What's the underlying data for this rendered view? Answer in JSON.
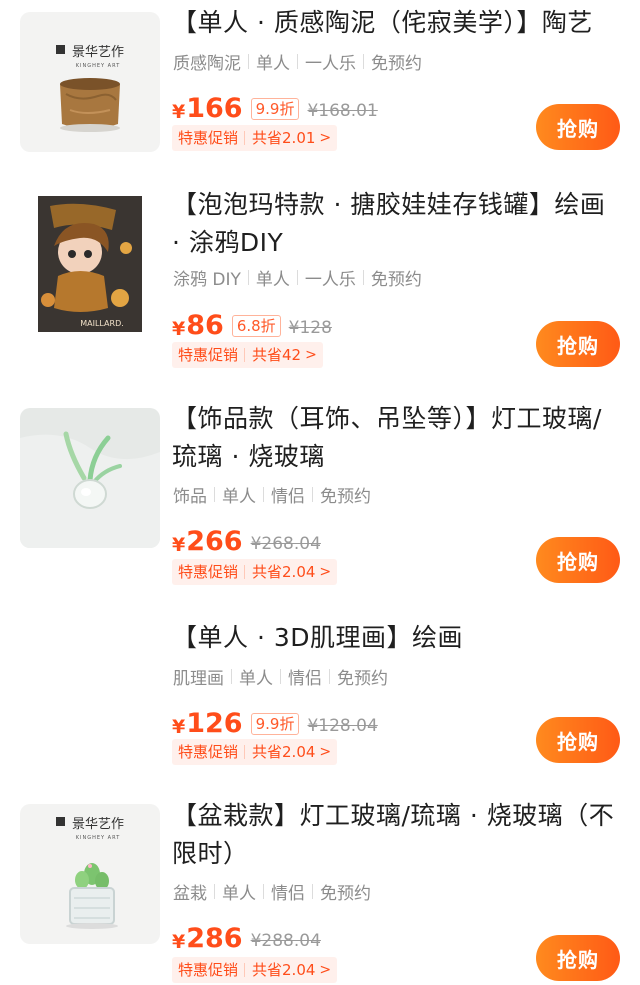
{
  "items": [
    {
      "title": "【单人 · 质感陶泥（侘寂美学）】陶艺",
      "tags": [
        "质感陶泥",
        "单人",
        "一人乐",
        "免预约"
      ],
      "currency": "¥",
      "price": "166",
      "discount": "9.9折",
      "original_price": "¥168.01",
      "promo_label": "特惠促销",
      "promo_save": "共省2.01",
      "buy_label": "抢购",
      "logo_text": "景华艺作",
      "logo_sub": "KINGHEY ART"
    },
    {
      "title": "【泡泡玛特款 · 搪胶娃娃存钱罐】绘画 · 涂鸦DIY",
      "tags": [
        "涂鸦 DIY",
        "单人",
        "一人乐",
        "免预约"
      ],
      "currency": "¥",
      "price": "86",
      "discount": "6.8折",
      "original_price": "¥128",
      "promo_label": "特惠促销",
      "promo_save": "共省42",
      "buy_label": "抢购",
      "image_text": "MAILLARD."
    },
    {
      "title": "【饰品款（耳饰、吊坠等）】灯工玻璃/琉璃 · 烧玻璃",
      "tags": [
        "饰品",
        "单人",
        "情侣",
        "免预约"
      ],
      "currency": "¥",
      "price": "266",
      "discount": "",
      "original_price": "¥268.04",
      "promo_label": "特惠促销",
      "promo_save": "共省2.04",
      "buy_label": "抢购"
    },
    {
      "title": "【单人 · 3D肌理画】绘画",
      "tags": [
        "肌理画",
        "单人",
        "情侣",
        "免预约"
      ],
      "currency": "¥",
      "price": "126",
      "discount": "9.9折",
      "original_price": "¥128.04",
      "promo_label": "特惠促销",
      "promo_save": "共省2.04",
      "buy_label": "抢购"
    },
    {
      "title": "【盆栽款】灯工玻璃/琉璃 · 烧玻璃（不限时）",
      "tags": [
        "盆栽",
        "单人",
        "情侣",
        "免预约"
      ],
      "currency": "¥",
      "price": "286",
      "discount": "",
      "original_price": "¥288.04",
      "promo_label": "特惠促销",
      "promo_save": "共省2.04",
      "buy_label": "抢购",
      "logo_text": "景华艺作",
      "logo_sub": "KINGHEY ART"
    }
  ],
  "colors": {
    "accent": "#ff4d1a",
    "button_start": "#ff8a1e",
    "button_end": "#ff5a16",
    "promo_bg": "#fff0ec",
    "tag_text": "#8c8c8c"
  },
  "icons": {
    "promo_arrow": "chevron-right-icon"
  }
}
